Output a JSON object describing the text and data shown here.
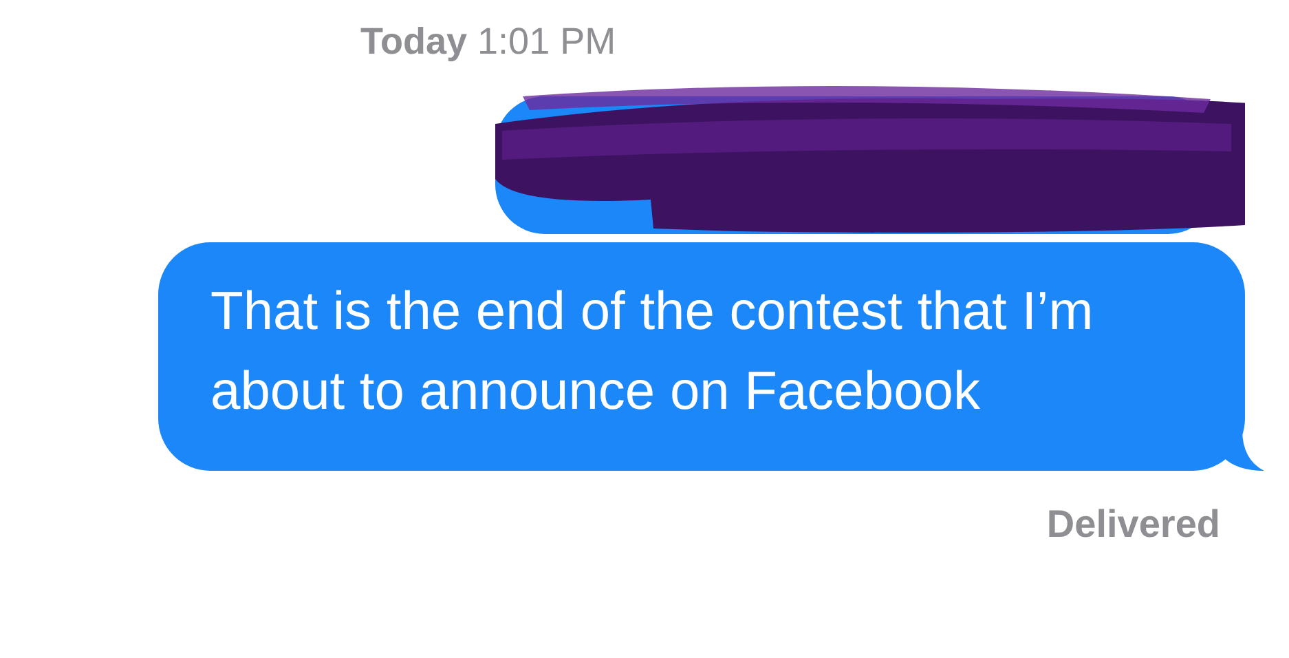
{
  "timestamp": {
    "day": "Today",
    "time": "1:01 PM"
  },
  "messages": [
    {
      "kind": "redacted"
    },
    {
      "kind": "text",
      "text": "That is the end of the contest that I’m about to announce on Facebook"
    }
  ],
  "status": "Delivered"
}
